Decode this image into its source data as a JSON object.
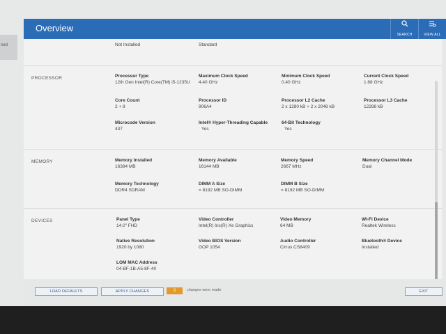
{
  "header": {
    "title": "Overview",
    "search_label": "SEARCH",
    "view_all_label": "VIEW ALL"
  },
  "left_strip": {
    "text": "ned"
  },
  "top_row": {
    "v1": "Not Installed",
    "v2": "Standard"
  },
  "sections": {
    "processor": {
      "label": "PROCESSOR",
      "fields": [
        {
          "label": "Processor Type",
          "value": "12th Gen Intel(R) Core(TM) i5-1235U"
        },
        {
          "label": "Maximum Clock Speed",
          "value": "4.40 GHz"
        },
        {
          "label": "Minimum Clock Speed",
          "value": "0.40 GHz"
        },
        {
          "label": "Current Clock Speed",
          "value": "1.68 GHz"
        },
        {
          "label": "Core Count",
          "value": "2 + 8"
        },
        {
          "label": "Processor ID",
          "value": "906A4"
        },
        {
          "label": "Processor L2 Cache",
          "value": "2 x 1280  kB + 2 x 2048  kB"
        },
        {
          "label": "Processor L3 Cache",
          "value": "12288 kB"
        },
        {
          "label": "Microcode Version",
          "value": "437"
        },
        {
          "label": "Intel® Hyper-Threading Capable",
          "value": "Yes"
        },
        {
          "label": "64-Bit Technology",
          "value": "Yes"
        }
      ]
    },
    "memory": {
      "label": "MEMORY",
      "fields": [
        {
          "label": "Memory Installed",
          "value": "16384 MB"
        },
        {
          "label": "Memory Available",
          "value": "16144 MB"
        },
        {
          "label": "Memory Speed",
          "value": "2667 MHz"
        },
        {
          "label": "Memory Channel Mode",
          "value": "Dual"
        },
        {
          "label": "Memory Technology",
          "value": "DDR4 SDRAM"
        },
        {
          "label": "DIMM A Size",
          "value": "= 8192 MB SO-DIMM"
        },
        {
          "label": "DIMM B Size",
          "value": "= 8192 MB SO-DIMM"
        }
      ]
    },
    "devices": {
      "label": "DEVICES",
      "fields": [
        {
          "label": "Panel Type",
          "value": "14.0\" FHD"
        },
        {
          "label": "Video Controller",
          "value": "Intel(R) Iris(R) Xe Graphics"
        },
        {
          "label": "Video Memory",
          "value": "64 MB"
        },
        {
          "label": "Wi-Fi Device",
          "value": "Realtek Wireless"
        },
        {
          "label": "Native Resolution",
          "value": "1920 by 1080"
        },
        {
          "label": "Video BIOS Version",
          "value": "GOP 1054"
        },
        {
          "label": "Audio Controller",
          "value": "Cirrus CS8409"
        },
        {
          "label": "Bluetooth® Device",
          "value": "Installed"
        },
        {
          "label": "LOM MAC Address",
          "value": "04-BF-1B-A5-8F-40"
        }
      ]
    }
  },
  "footer": {
    "load_defaults": "LOAD DEFAULTS",
    "apply_changes": "APPLY CHANGES",
    "changes_count": "0",
    "changes_text": "changes were made",
    "exit": "EXIT"
  }
}
